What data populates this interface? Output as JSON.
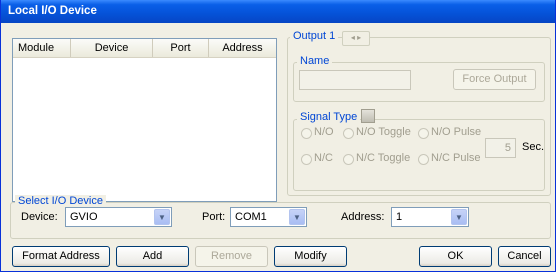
{
  "window": {
    "title": "Local I/O Device"
  },
  "list": {
    "columns": [
      "Module",
      "Device",
      "Port",
      "Address"
    ]
  },
  "output": {
    "label": "Output 1",
    "nav_prev": "◂",
    "nav_next": "▸",
    "name_label": "Name",
    "name_value": "",
    "force_output": "Force Output"
  },
  "signal": {
    "label": "Signal Type",
    "options": [
      "N/O",
      "N/O Toggle",
      "N/O Pulse",
      "N/C",
      "N/C Toggle",
      "N/C Pulse"
    ],
    "pulse_value": "5",
    "pulse_unit": "Sec."
  },
  "select_device": {
    "label": "Select I/O Device",
    "device_label": "Device:",
    "device_value": "GVIO",
    "port_label": "Port:",
    "port_value": "COM1",
    "address_label": "Address:",
    "address_value": "1"
  },
  "buttons": {
    "format_address": "Format Address",
    "add": "Add",
    "remove": "Remove",
    "modify": "Modify",
    "ok": "OK",
    "cancel": "Cancel"
  }
}
